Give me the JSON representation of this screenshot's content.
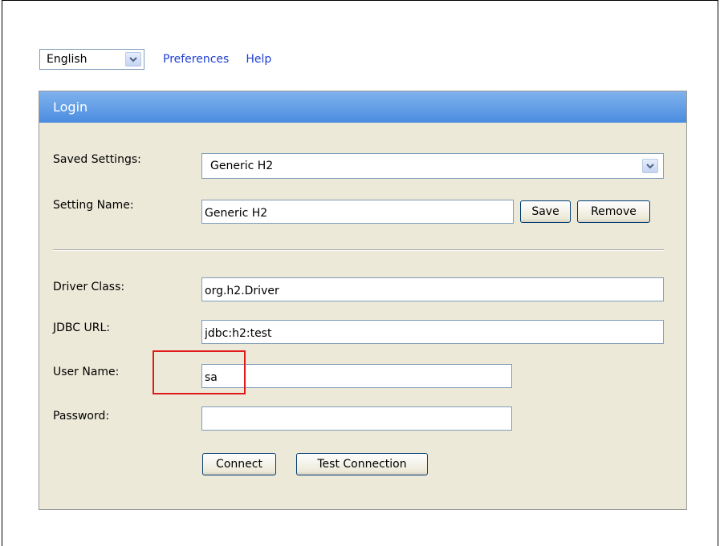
{
  "language": {
    "selected": "English",
    "icon": "chevron-down-icon"
  },
  "top_links": {
    "preferences": "Preferences",
    "help": "Help"
  },
  "login": {
    "title": "Login",
    "saved_settings": {
      "label": "Saved Settings:",
      "value": "Generic H2"
    },
    "setting_name": {
      "label": "Setting Name:",
      "value": "Generic H2",
      "save_label": "Save",
      "remove_label": "Remove"
    },
    "driver_class": {
      "label": "Driver Class:",
      "value": "org.h2.Driver"
    },
    "jdbc_url": {
      "label": "JDBC URL:",
      "value": "jdbc:h2:test"
    },
    "user_name": {
      "label": "User Name:",
      "value": "sa"
    },
    "password": {
      "label": "Password:",
      "value": ""
    },
    "connect_label": "Connect",
    "test_connection_label": "Test Connection"
  },
  "colors": {
    "header_gradient_top": "#7fb2ec",
    "header_gradient_bottom": "#4b8ce0",
    "panel_background": "#ece9d8",
    "link": "#1f3fd0",
    "highlight": "#e01b1b"
  }
}
